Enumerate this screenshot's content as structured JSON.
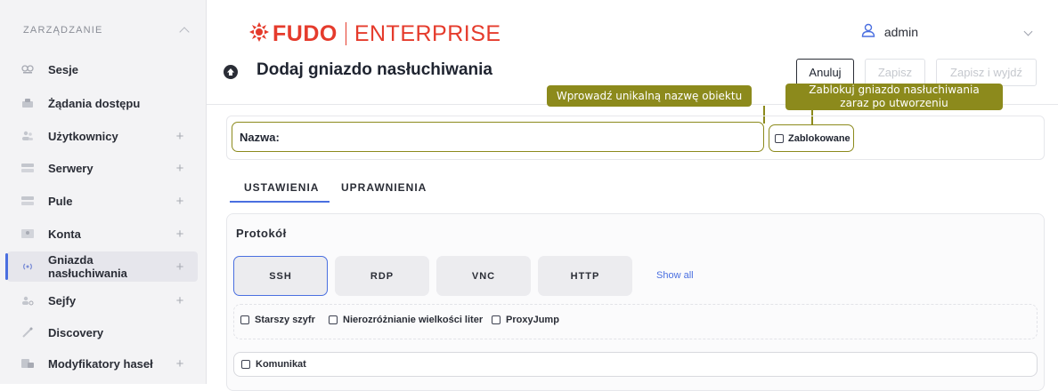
{
  "sidebar": {
    "title": "ZARZĄDZANIE",
    "items": [
      {
        "label": "Sesje",
        "icon": "sessions-icon",
        "expandable": false
      },
      {
        "label": "Żądania dostępu",
        "icon": "access-requests-icon",
        "expandable": false
      },
      {
        "label": "Użytkownicy",
        "icon": "users-icon",
        "expandable": true,
        "expand": "+"
      },
      {
        "label": "Serwery",
        "icon": "servers-icon",
        "expandable": true,
        "expand": "+"
      },
      {
        "label": "Pule",
        "icon": "pools-icon",
        "expandable": true,
        "expand": "+"
      },
      {
        "label": "Konta",
        "icon": "accounts-icon",
        "expandable": true,
        "expand": "+"
      },
      {
        "label": "Gniazda nasłuchiwania",
        "icon": "listeners-icon",
        "expandable": true,
        "expand": "+",
        "active": true
      },
      {
        "label": "Sejfy",
        "icon": "safes-icon",
        "expandable": true,
        "expand": "+"
      },
      {
        "label": "Discovery",
        "icon": "discovery-icon",
        "expandable": false
      },
      {
        "label": "Modyfikatory haseł",
        "icon": "password-changers-icon",
        "expandable": true,
        "expand": "+"
      }
    ]
  },
  "header": {
    "logo_main": "FUDO",
    "logo_sub": "ENTERPRISE",
    "user": "admin",
    "brand_color": "#e53b2c"
  },
  "page": {
    "title": "Dodaj gniazdo nasłuchiwania",
    "cancel_label": "Anuluj",
    "save_label": "Zapisz",
    "save_exit_label": "Zapisz i wyjdź"
  },
  "tooltips": {
    "name": "Wprowadź unikalną nazwę obiektu",
    "lock_line1": "Zablokuj gniazdo nasłuchiwania",
    "lock_line2": "zaraz po utworzeniu",
    "color": "#8c8a1c"
  },
  "form": {
    "name_label": "Nazwa:",
    "name_value": "",
    "locked_label": "Zablokowane"
  },
  "tabs": {
    "settings": "USTAWIENIA",
    "permissions": "UPRAWNIENIA",
    "active": "settings"
  },
  "protocol": {
    "heading": "Protokół",
    "options": [
      "SSH",
      "RDP",
      "VNC",
      "HTTP"
    ],
    "selected": "SSH",
    "show_all": "Show all",
    "accent": "#4a6fe0"
  },
  "ssh_options": {
    "legacy_cipher": "Starszy szyfr",
    "case_insensitive": "Nierozróżnianie wielkości liter",
    "proxyjump": "ProxyJump"
  },
  "message": {
    "label": "Komunikat"
  }
}
